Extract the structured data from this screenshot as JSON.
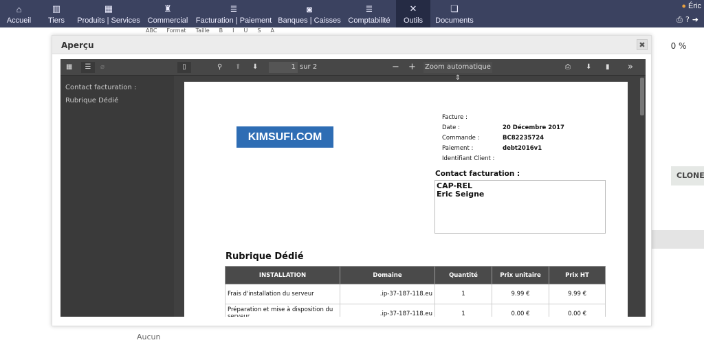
{
  "nav": {
    "items": [
      {
        "label": "Accueil",
        "icon": "home-icon",
        "glyph": "⌂"
      },
      {
        "label": "Tiers",
        "icon": "building-icon",
        "glyph": "▥"
      },
      {
        "label": "Produits | Services",
        "icon": "boxes-icon",
        "glyph": "▦"
      },
      {
        "label": "Commercial",
        "icon": "tie-icon",
        "glyph": "♜"
      },
      {
        "label": "Facturation | Paiement",
        "icon": "coins-icon",
        "glyph": "≣"
      },
      {
        "label": "Banques | Caisses",
        "icon": "safe-icon",
        "glyph": "◙"
      },
      {
        "label": "Comptabilité",
        "icon": "coins-icon",
        "glyph": "≣"
      },
      {
        "label": "Outils",
        "icon": "tools-icon",
        "glyph": "✕"
      },
      {
        "label": "Documents",
        "icon": "documents-icon",
        "glyph": "❏"
      }
    ],
    "active": "Outils",
    "user": "Éric"
  },
  "background": {
    "editor_tools": [
      "ABC",
      "Format",
      "Taille",
      "B",
      "I",
      "U",
      "S",
      "A"
    ],
    "percent": "0 %",
    "cloner": "CLONER",
    "aucun": "Aucun"
  },
  "modal": {
    "title": "Aperçu",
    "close": "✖"
  },
  "viewer": {
    "page_current": "1",
    "page_total": "sur 2",
    "zoom": "Zoom automatique ⇕",
    "outline": [
      "Contact facturation :",
      "Rubrique Dédié"
    ]
  },
  "invoice": {
    "logo": "KIMSUFI.COM",
    "meta": [
      {
        "label": "Facture :",
        "value": ""
      },
      {
        "label": "Date :",
        "value": "20 Décembre 2017"
      },
      {
        "label": "Commande :",
        "value": "BC82235724"
      },
      {
        "label": "Paiement :",
        "value": "debt2016v1"
      },
      {
        "label": "Identifiant Client :",
        "value": ""
      }
    ],
    "contact_label": "Contact facturation :",
    "contact": [
      "CAP-REL",
      "Eric Seigne"
    ],
    "section": "Rubrique Dédié",
    "headers": [
      "INSTALLATION",
      "Domaine",
      "Quantité",
      "Prix unitaire",
      "Prix HT"
    ],
    "rows": [
      [
        "Frais d'installation du serveur",
        ".ip-37-187-118.eu",
        "1",
        "9.99 €",
        "9.99 €"
      ],
      [
        "Préparation et mise à disposition du serveur",
        ".ip-37-187-118.eu",
        "1",
        "0.00 €",
        "0.00 €"
      ]
    ]
  }
}
